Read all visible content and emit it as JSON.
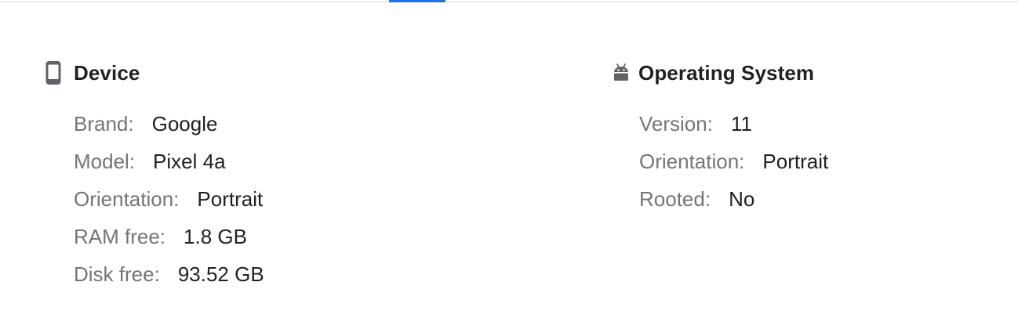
{
  "device": {
    "title": "Device",
    "icon": "smartphone-icon",
    "rows": [
      {
        "label": "Brand:",
        "value": "Google"
      },
      {
        "label": "Model:",
        "value": "Pixel 4a"
      },
      {
        "label": "Orientation:",
        "value": "Portrait"
      },
      {
        "label": "RAM free:",
        "value": "1.8 GB"
      },
      {
        "label": "Disk free:",
        "value": "93.52 GB"
      }
    ]
  },
  "os": {
    "title": "Operating System",
    "icon": "android-icon",
    "rows": [
      {
        "label": "Version:",
        "value": "11"
      },
      {
        "label": "Orientation:",
        "value": "Portrait"
      },
      {
        "label": "Rooted:",
        "value": "No"
      }
    ]
  },
  "colors": {
    "accent": "#1a73e8",
    "label": "#757575",
    "value": "#202124"
  }
}
